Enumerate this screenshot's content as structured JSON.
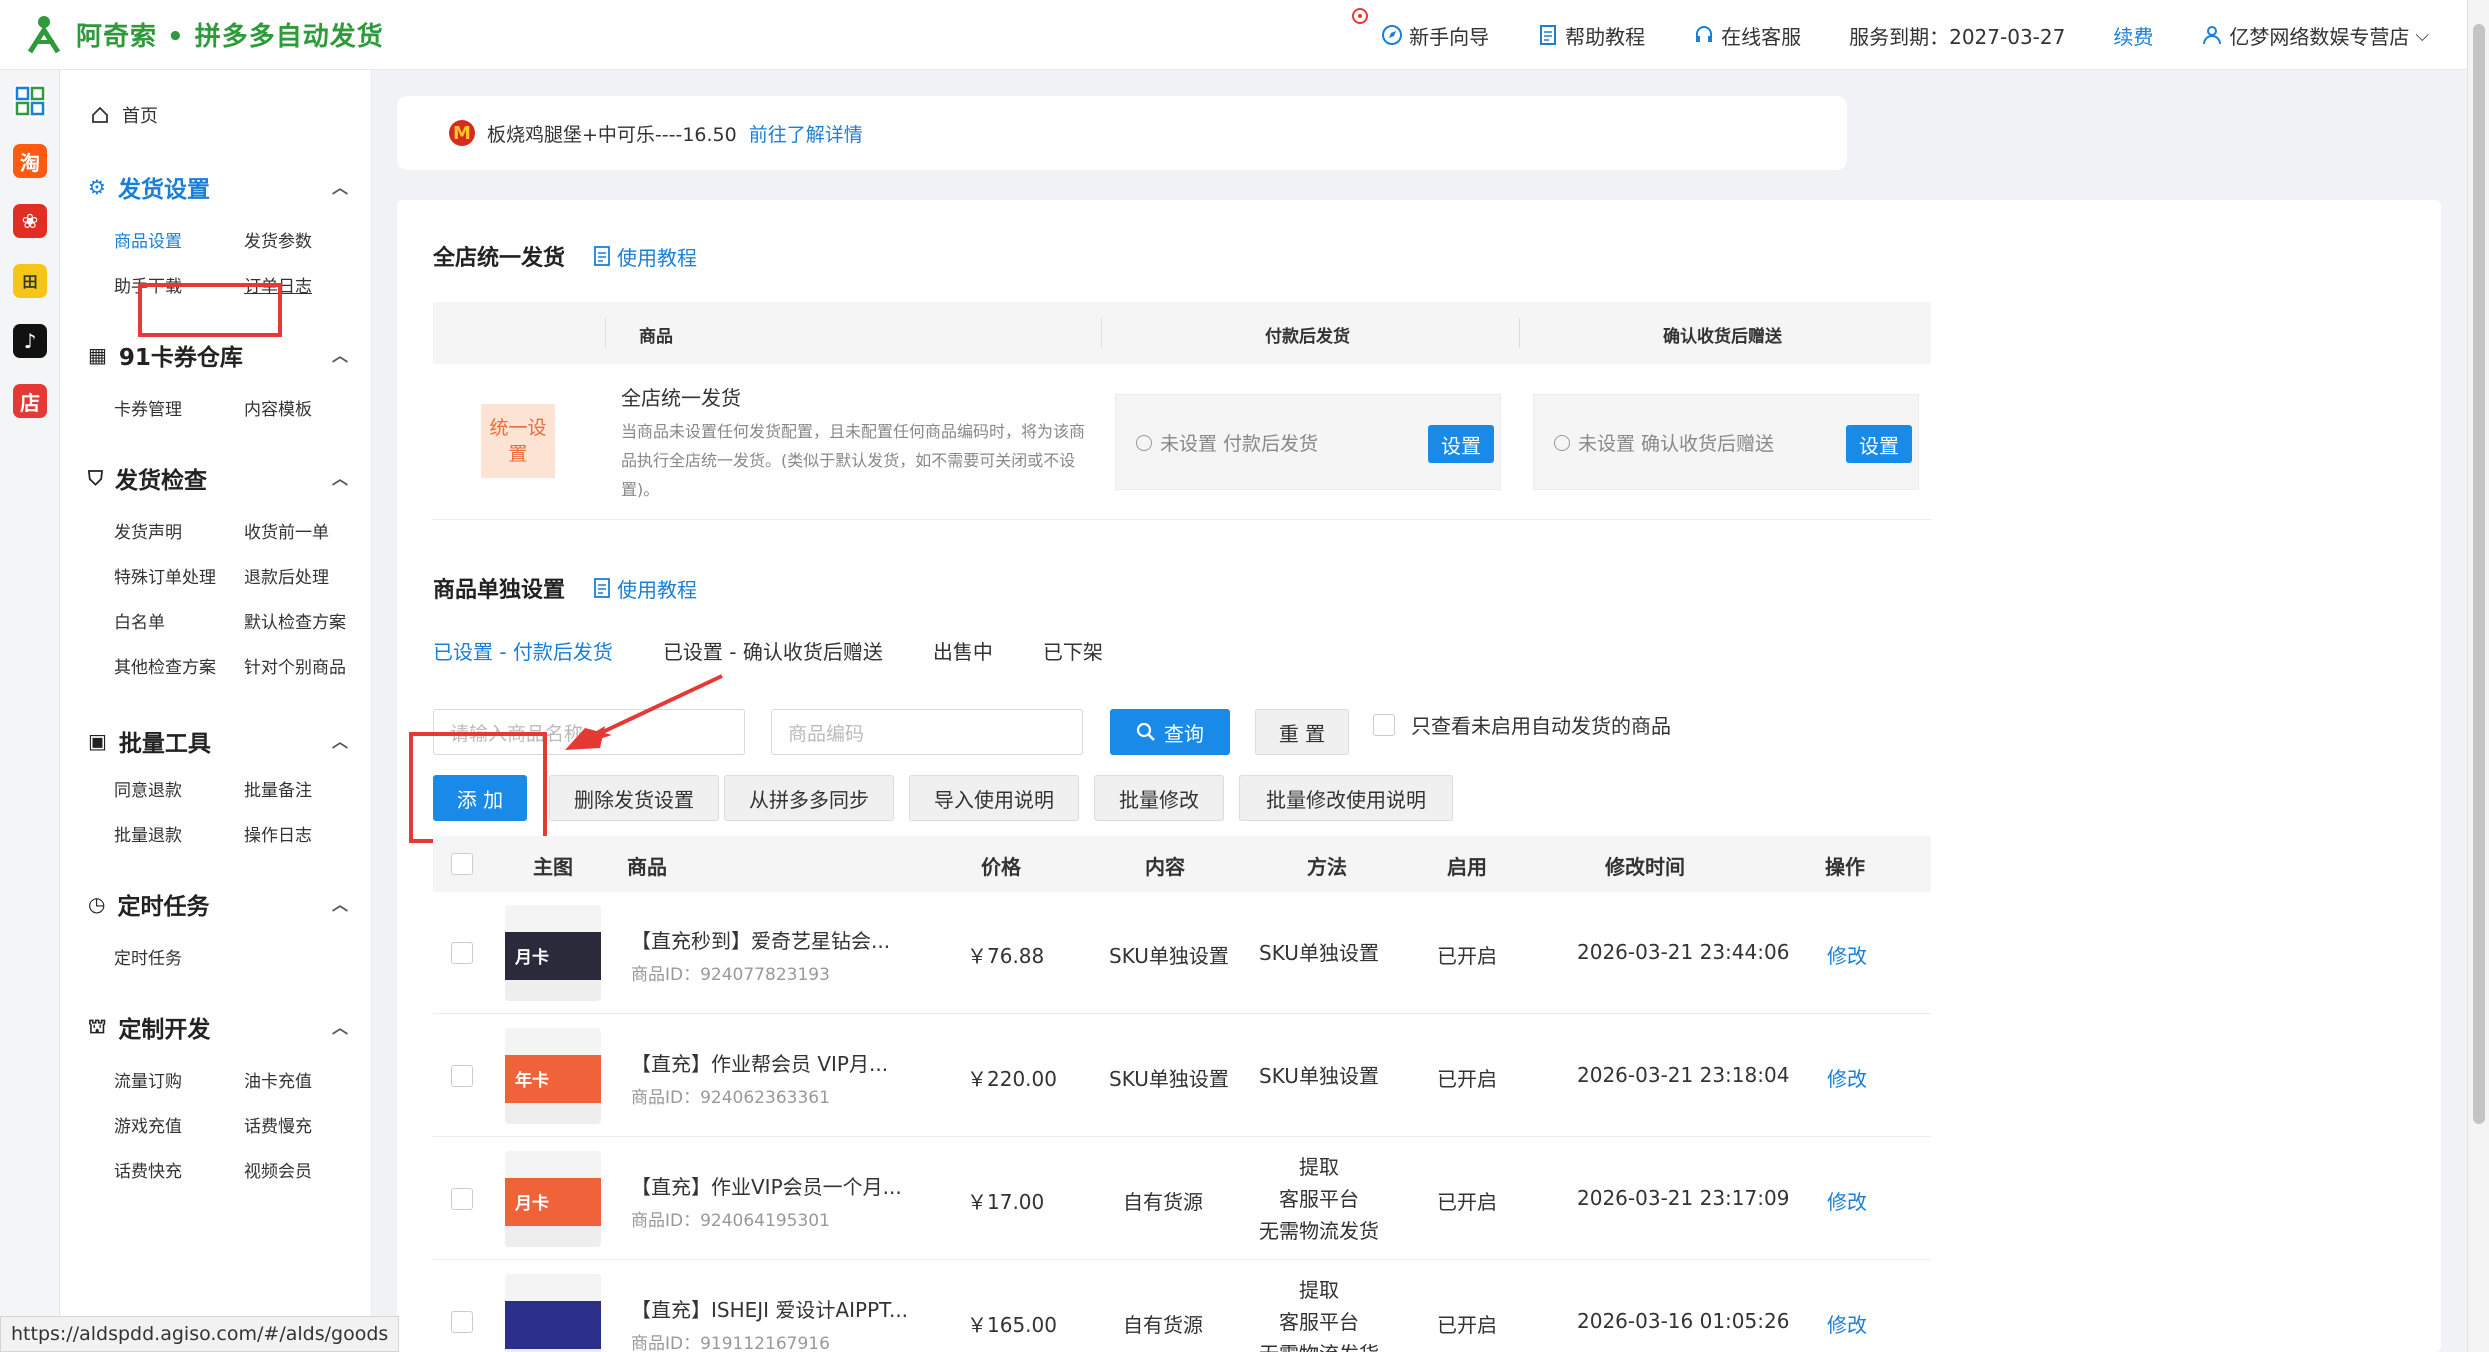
{
  "header": {
    "brand": "阿奇索 • 拼多多自动发货",
    "guide": "新手向导",
    "help": "帮助教程",
    "service": "在线客服",
    "expiry": "服务到期：2027-03-27",
    "renew": "续费",
    "shop": "亿梦网络数娱专营店"
  },
  "rail": [
    {
      "name": "grid-app-icon",
      "glyph": "▦",
      "color": "#ffffff"
    },
    {
      "name": "taobao-icon",
      "glyph": "淘",
      "color": "#ff5a12"
    },
    {
      "name": "pinduoduo-icon",
      "glyph": "❀",
      "color": "#e02e24"
    },
    {
      "name": "tianmao-icon",
      "glyph": "田",
      "color": "#f5c518"
    },
    {
      "name": "douyin-icon",
      "glyph": "♪",
      "color": "#111111"
    },
    {
      "name": "dian-icon",
      "glyph": "店",
      "color": "#e53935"
    }
  ],
  "sidebar": {
    "home": "首页",
    "sections": [
      {
        "title": "发货设置",
        "items": [
          "商品设置",
          "发货参数",
          "助手下载",
          "订单日志"
        ]
      },
      {
        "title": "91卡券仓库",
        "items": [
          "卡券管理",
          "内容模板"
        ]
      },
      {
        "title": "发货检查",
        "items": [
          "发货声明",
          "收货前一单",
          "特殊订单处理",
          "退款后处理",
          "白名单",
          "默认检查方案",
          "其他检查方案",
          "针对个别商品"
        ]
      },
      {
        "title": "批量工具",
        "items": [
          "同意退款",
          "批量备注",
          "批量退款",
          "操作日志"
        ]
      },
      {
        "title": "定时任务",
        "items": [
          "定时任务"
        ]
      },
      {
        "title": "定制开发",
        "items": [
          "流量订购",
          "油卡充值",
          "游戏充值",
          "话费慢充",
          "话费快充",
          "视频会员"
        ]
      }
    ]
  },
  "notice": {
    "text": "板烧鸡腿堡+中可乐----16.50",
    "link": "前往了解详情"
  },
  "global": {
    "title": "全店统一发货",
    "tutorial": "使用教程",
    "col_product": "商品",
    "col_after_pay": "付款后发货",
    "col_after_confirm": "确认收货后赠送",
    "badge": "统一设置",
    "name": "全店统一发货",
    "desc": "当商品未设置任何发货配置，且未配置任何商品编码时，将为该商品执行全店统一发货。(类似于默认发货，如不需要可关闭或不设置)。",
    "after_pay_status": "未设置 付款后发货",
    "after_confirm_status": "未设置 确认收货后赠送",
    "set_btn": "设置"
  },
  "single": {
    "title": "商品单独设置",
    "tutorial": "使用教程",
    "tabs": [
      "已设置 - 付款后发货",
      "已设置 - 确认收货后赠送",
      "出售中",
      "已下架"
    ],
    "name_placeholder": "请输入商品名称",
    "code_placeholder": "商品编码",
    "query": "查询",
    "reset": "重 置",
    "only_disabled": "只查看未启用自动发货的商品",
    "add": "添 加",
    "actions": [
      "删除发货设置",
      "从拼多多同步",
      "导入使用说明",
      "批量修改",
      "批量修改使用说明"
    ]
  },
  "table": {
    "headers": [
      "主图",
      "商品",
      "价格",
      "内容",
      "方法",
      "启用",
      "修改时间",
      "操作"
    ],
    "rows": [
      {
        "name": "【直充秒到】爱奇艺星钻会...",
        "id": "商品ID：924077823193",
        "price": "￥76.88",
        "content": "SKU单独设置",
        "method": [
          "SKU单独设置"
        ],
        "enabled": "已开启",
        "time": "2026-03-21 23:44:06",
        "op": "修改",
        "thumb": "月卡",
        "thumb_color": "#2a2a3a"
      },
      {
        "name": "【直充】作业帮会员 VIP月...",
        "id": "商品ID：924062363361",
        "price": "￥220.00",
        "content": "SKU单独设置",
        "method": [
          "SKU单独设置"
        ],
        "enabled": "已开启",
        "time": "2026-03-21 23:18:04",
        "op": "修改",
        "thumb": "年卡",
        "thumb_color": "#f0623a"
      },
      {
        "name": "【直充】作业VIP会员一个月...",
        "id": "商品ID：924064195301",
        "price": "￥17.00",
        "content": "自有货源",
        "method": [
          "提取",
          "客服平台",
          "无需物流发货"
        ],
        "enabled": "已开启",
        "time": "2026-03-21 23:17:09",
        "op": "修改",
        "thumb": "月卡",
        "thumb_color": "#f0623a"
      },
      {
        "name": "【直充】ISHEJI 爱设计AIPPT...",
        "id": "商品ID：919112167916",
        "price": "￥165.00",
        "content": "自有货源",
        "method": [
          "提取",
          "客服平台",
          "无需物流发货"
        ],
        "enabled": "已开启",
        "time": "2026-03-16 01:05:26",
        "op": "修改",
        "thumb": "",
        "thumb_color": "#2b2f8a"
      }
    ]
  },
  "statusbar": "https://aldspdd.agiso.com/#/alds/goods"
}
